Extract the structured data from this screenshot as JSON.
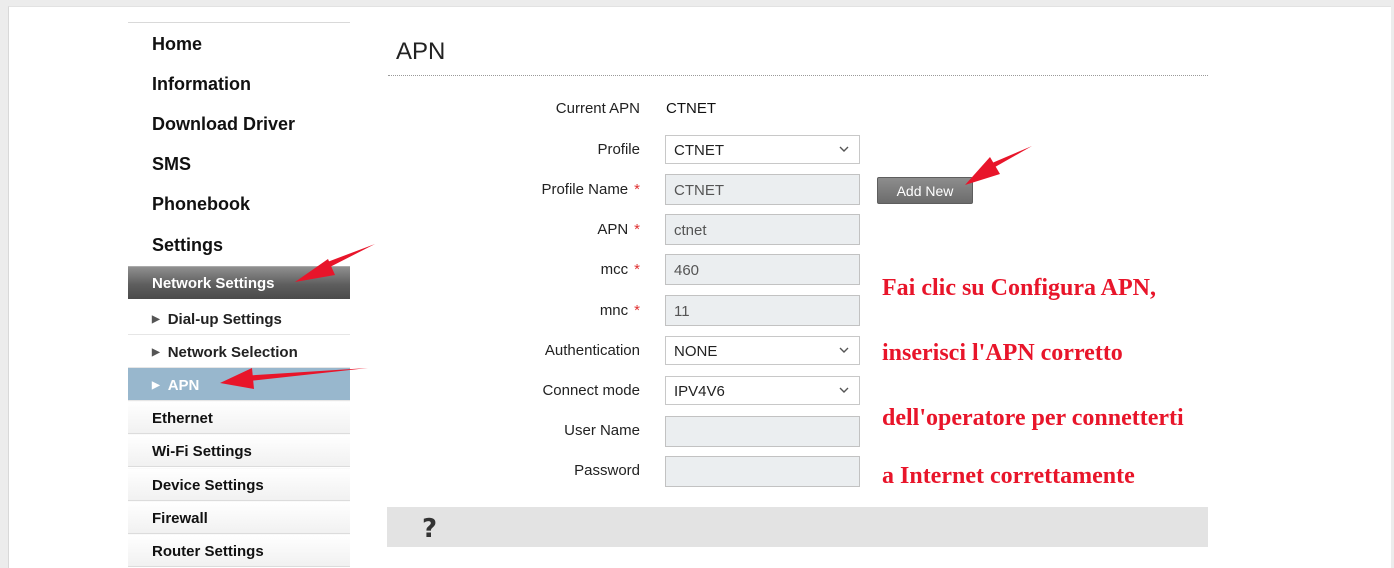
{
  "sidebar": {
    "main_items": [
      "Home",
      "Information",
      "Download Driver",
      "SMS",
      "Phonebook",
      "Settings"
    ],
    "network_settings_label": "Network Settings",
    "sub_items": [
      {
        "label": "Dial-up Settings",
        "active": false
      },
      {
        "label": "Network Selection",
        "active": false
      },
      {
        "label": "APN",
        "active": true
      }
    ],
    "categories": [
      "Ethernet",
      "Wi-Fi Settings",
      "Device Settings",
      "Firewall",
      "Router Settings"
    ]
  },
  "main": {
    "title": "APN",
    "current_apn_label": "Current APN",
    "current_apn_value": "CTNET",
    "profile_label": "Profile",
    "profile_value": "CTNET",
    "profile_name_label": "Profile Name",
    "profile_name_value": "CTNET",
    "apn_label": "APN",
    "apn_value": "ctnet",
    "mcc_label": "mcc",
    "mcc_value": "460",
    "mnc_label": "mnc",
    "mnc_value": "11",
    "authentication_label": "Authentication",
    "authentication_value": "NONE",
    "connect_mode_label": "Connect mode",
    "connect_mode_value": "IPV4V6",
    "user_name_label": "User Name",
    "user_name_value": "",
    "password_label": "Password",
    "password_value": "",
    "required_mark": "*",
    "add_new_label": "Add New",
    "help_symbol": "?"
  },
  "annotation": {
    "lines": [
      "Fai clic su Configura APN,",
      "inserisci l'APN corretto",
      "dell'operatore per connetterti",
      "a Internet correttamente"
    ],
    "color": "#e8152a"
  },
  "colors": {
    "active_nav": "#98b7cd",
    "nav_header": "#5e5e5e",
    "button": "#7a7a7a"
  }
}
